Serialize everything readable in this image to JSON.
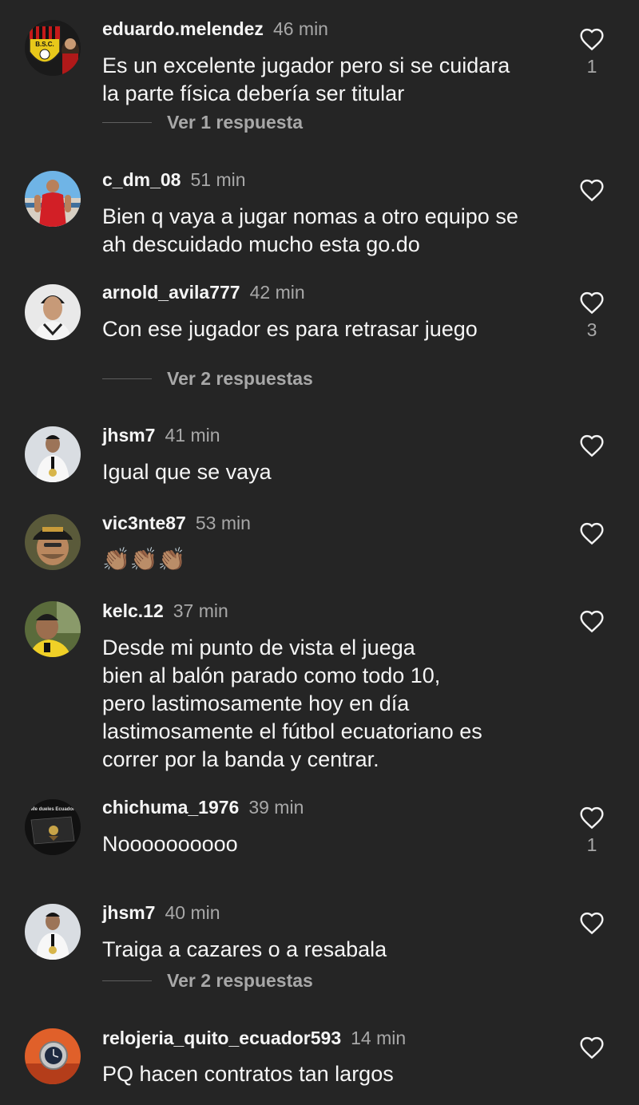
{
  "comments": [
    {
      "username": "eduardo.melendez",
      "time": "46 min",
      "text": "Es un excelente jugador pero si se cuidara\nla parte física debería ser titular",
      "likes": "1",
      "replies": "Ver 1 respuesta",
      "avatar": "bsc-crest-avatar"
    },
    {
      "username": "c_dm_08",
      "time": "51 min",
      "text": "Bien q vaya a jugar nomas a otro equipo se\nah descuidado mucho esta go.do",
      "likes": "",
      "replies": "",
      "avatar": "red-shirt-avatar"
    },
    {
      "username": "arnold_avila777",
      "time": "42 min",
      "text": "Con ese jugador es para retrasar juego",
      "likes": "3",
      "replies": "Ver 2 respuestas",
      "avatar": "young-man-avatar"
    },
    {
      "username": "jhsm7",
      "time": "41 min",
      "text": "Igual que se vaya",
      "likes": "",
      "replies": "",
      "avatar": "suit-man-avatar"
    },
    {
      "username": "vic3nte87",
      "time": "53 min",
      "text": "👏🏽👏🏽👏🏽",
      "likes": "",
      "replies": "",
      "avatar": "cap-man-avatar"
    },
    {
      "username": "kelc.12",
      "time": "37 min",
      "text": "Desde mi punto de vista el juega\nbien al balón parado como todo 10,\npero lastimosamente hoy en día\nlastimosamente el fútbol ecuatoriano es\ncorrer por la banda y centrar.",
      "likes": "",
      "replies": "",
      "avatar": "yellow-shirt-avatar"
    },
    {
      "username": "chichuma_1976",
      "time": "39 min",
      "text": "Noooooooooo",
      "likes": "1",
      "replies": "",
      "avatar": "flag-avatar",
      "avatar_caption": "Me dueles Ecuador"
    },
    {
      "username": "jhsm7",
      "time": "40 min",
      "text": "Traiga a cazares o a resabala",
      "likes": "",
      "replies": "Ver 2 respuestas",
      "avatar": "suit-man-avatar"
    },
    {
      "username": "relojeria_quito_ecuador593",
      "time": "14 min",
      "text": "PQ hacen contratos tan largos",
      "likes": "",
      "replies": "",
      "avatar": "watch-avatar"
    }
  ],
  "icons": {
    "like": "heart-outline-icon"
  },
  "colors": {
    "background": "#252525",
    "text": "#f5f5f5",
    "muted": "#a8a8a8"
  },
  "avatar_badge": {
    "bsc": "B.S.C."
  }
}
